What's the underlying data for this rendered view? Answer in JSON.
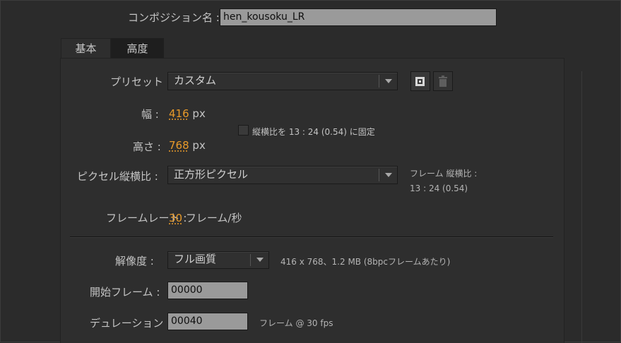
{
  "comp_name": {
    "label": "コンポジション名 :",
    "value": "hen_kousoku_LR"
  },
  "tabs": [
    {
      "label": "基本"
    },
    {
      "label": "高度"
    }
  ],
  "preset": {
    "label": "プリセット :",
    "value": "カスタム",
    "save_icon": "save-preset-icon",
    "delete_icon": "trash-icon"
  },
  "width": {
    "label": "幅 :",
    "value": "416",
    "unit": "px"
  },
  "height": {
    "label": "高さ :",
    "value": "768",
    "unit": "px"
  },
  "aspect_lock": {
    "label": "縦横比を 13 : 24 (0.54) に固定",
    "checked": false
  },
  "pixel_aspect": {
    "label": "ピクセル縦横比 :",
    "value": "正方形ピクセル",
    "frame_aspect_label": "フレーム 縦横比 :",
    "frame_aspect_value": "13 : 24 (0.54)"
  },
  "frame_rate": {
    "label": "フレームレート :",
    "value": "30",
    "unit": "フレーム/秒"
  },
  "resolution": {
    "label": "解像度 :",
    "value": "フル画質",
    "info": "416 x 768、1.2 MB (8bpcフレームあたり)"
  },
  "start_frame": {
    "label": "開始フレーム :",
    "value": "00000"
  },
  "duration": {
    "label": "デュレーション :",
    "value": "00040",
    "info": "フレーム @ 30 fps"
  },
  "colors": {
    "accent": "#e89a2a",
    "field_bg": "#9a9a9a",
    "panel_bg": "#2e2e2e"
  }
}
